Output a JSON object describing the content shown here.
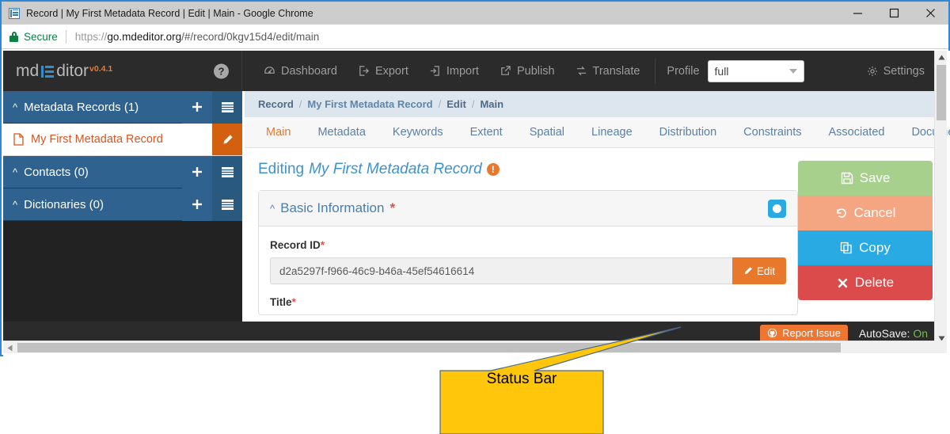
{
  "browser": {
    "title": "Record | My First Metadata Record | Edit | Main - Google Chrome",
    "favicon": "record-list-icon",
    "security_label": "Secure",
    "url_parts": {
      "scheme": "https://",
      "host": "go.mdeditor.org",
      "path": "/#/record/0kgv15d4/edit/main"
    },
    "window_controls": {
      "minimize": "minimize-icon",
      "maximize": "maximize-icon",
      "close": "close-icon"
    }
  },
  "app": {
    "brand": {
      "prefix": "md",
      "suffix": "ditor",
      "version": "v0.4.1"
    },
    "help_icon": "?",
    "nav": [
      {
        "label": "Dashboard",
        "icon": "dashboard-icon"
      },
      {
        "label": "Export",
        "icon": "export-icon"
      },
      {
        "label": "Import",
        "icon": "import-icon"
      },
      {
        "label": "Publish",
        "icon": "publish-icon"
      },
      {
        "label": "Translate",
        "icon": "translate-icon"
      }
    ],
    "profile": {
      "label": "Profile",
      "value": "full",
      "options": [
        "full"
      ]
    },
    "settings": {
      "label": "Settings",
      "icon": "gear-icon"
    }
  },
  "sidebar": {
    "groups": [
      {
        "label": "Metadata Records (1)",
        "add": "+",
        "list": "list-icon"
      },
      {
        "label": "Contacts (0)",
        "add": "+",
        "list": "list-icon"
      },
      {
        "label": "Dictionaries (0)",
        "add": "+",
        "list": "list-icon"
      }
    ],
    "record_item": {
      "label": "My First Metadata Record",
      "icon": "document-icon",
      "edit_icon": "pencil-icon"
    }
  },
  "content": {
    "breadcrumb": [
      "Record",
      "My First Metadata Record",
      "Edit",
      "Main"
    ],
    "breadcrumb_sep": "/",
    "tabs": [
      "Main",
      "Metadata",
      "Keywords",
      "Extent",
      "Spatial",
      "Lineage",
      "Distribution",
      "Constraints",
      "Associated",
      "Documents"
    ],
    "active_tab": "Main",
    "editing": {
      "prefix": "Editing",
      "record": "My First Metadata Record",
      "warning_icon": "!"
    },
    "panel": {
      "title": "Basic Information",
      "required_marker": "*",
      "collapse_caret": "⌃",
      "toggle": "toggle-on"
    },
    "fields": [
      {
        "label": "Record ID",
        "required": "*",
        "value": "d2a5297f-f966-46c9-b46a-45ef54616614",
        "button": "Edit",
        "button_icon": "pencil-icon"
      },
      {
        "label": "Title",
        "required": "*",
        "value": ""
      }
    ],
    "actions": [
      {
        "label": "Save",
        "icon": "save-icon",
        "color": "#a8d08d"
      },
      {
        "label": "Cancel",
        "icon": "undo-icon",
        "color": "#f4a582"
      },
      {
        "label": "Copy",
        "icon": "copy-icon",
        "color": "#29aae2"
      },
      {
        "label": "Delete",
        "icon": "times-icon",
        "color": "#dc4b4b"
      }
    ]
  },
  "statusbar": {
    "report_issue": {
      "label": "Report Issue",
      "icon": "github-icon"
    },
    "autosave_label": "AutoSave:",
    "autosave_value": "On",
    "autosave_color": "#6fbf4a"
  },
  "annotation": {
    "label": "Status Bar",
    "fill_color": "#FFC60B",
    "stroke_color": "#4a6a8a"
  }
}
